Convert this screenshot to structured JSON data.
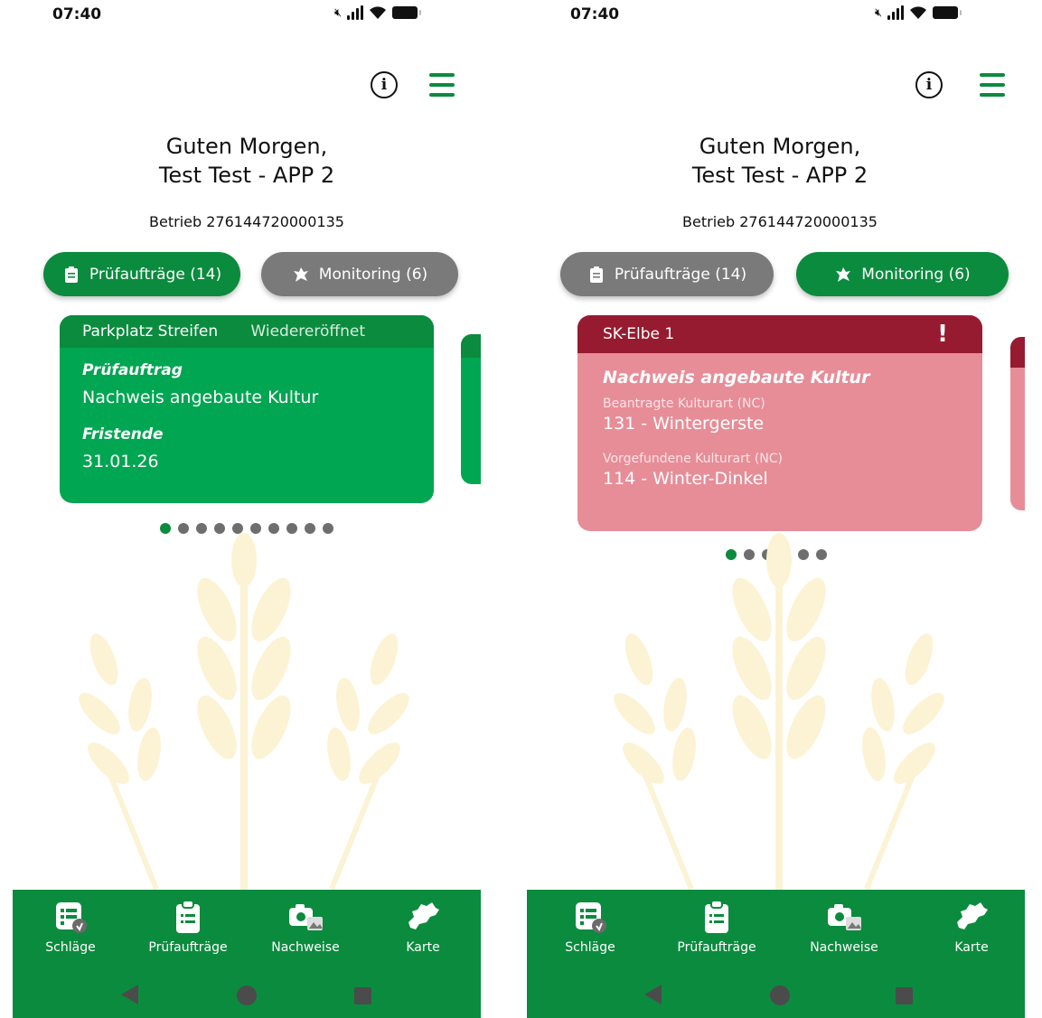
{
  "screens": [
    {
      "status_time": "07:40",
      "greeting_line1": "Guten Morgen,",
      "greeting_line2": "Test Test - APP 2",
      "betrieb": "Betrieb 276144720000135",
      "tabs": {
        "pruefauftraege": "Prüfaufträge (14)",
        "monitoring": "Monitoring (6)",
        "active": "pruefauftraege"
      },
      "card": {
        "field_name": "Parkplatz Streifen",
        "status": "Wiedereröffnet",
        "label_1": "Prüfauftrag",
        "value_1": "Nachweis angebaute Kultur",
        "label_2": "Fristende",
        "value_2": "31.01.26"
      },
      "pagination": {
        "total": 10,
        "active": 0
      }
    },
    {
      "status_time": "07:40",
      "greeting_line1": "Guten Morgen,",
      "greeting_line2": "Test Test - APP 2",
      "betrieb": "Betrieb 276144720000135",
      "tabs": {
        "pruefauftraege": "Prüfaufträge (14)",
        "monitoring": "Monitoring (6)",
        "active": "monitoring"
      },
      "card": {
        "field_name": "SK-Elbe 1",
        "alert": "!",
        "title": "Nachweis angebaute Kultur",
        "label_1": "Beantragte Kulturart (NC)",
        "value_1": "131 - Wintergerste",
        "label_2": "Vorgefundene Kulturart (NC)",
        "value_2": "114 - Winter-Dinkel"
      },
      "pagination": {
        "total": 6,
        "active": 0
      }
    }
  ],
  "bottom_nav": {
    "items": [
      {
        "label": "Schläge",
        "icon": "field-list-icon"
      },
      {
        "label": "Prüfaufträge",
        "icon": "clipboard-list-icon"
      },
      {
        "label": "Nachweise",
        "icon": "camera-gallery-icon"
      },
      {
        "label": "Karte",
        "icon": "map-saxony-icon"
      }
    ]
  },
  "colors": {
    "primary_green": "#0b8b3e",
    "card_green": "#00a651",
    "inactive_gray": "#7a7a7a",
    "alert_red": "#971b30",
    "alert_pink": "#e78d98",
    "wheat_watermark": "#fbf3d4"
  }
}
